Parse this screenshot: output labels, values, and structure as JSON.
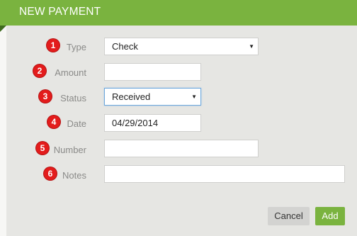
{
  "dialog": {
    "title": "NEW PAYMENT",
    "accent_color": "#7ab33f",
    "badge_color": "#e31c1c"
  },
  "form": {
    "type": {
      "badge": "1",
      "label": "Type",
      "value": "Check"
    },
    "amount": {
      "badge": "2",
      "label": "Amount",
      "value": ""
    },
    "status": {
      "badge": "3",
      "label": "Status",
      "value": "Received"
    },
    "date": {
      "badge": "4",
      "label": "Date",
      "value": "04/29/2014"
    },
    "number": {
      "badge": "5",
      "label": "Number",
      "value": ""
    },
    "notes": {
      "badge": "6",
      "label": "Notes",
      "value": ""
    }
  },
  "icons": {
    "dropdown": "caret-down-icon"
  },
  "footer": {
    "cancel_label": "Cancel",
    "add_label": "Add"
  }
}
